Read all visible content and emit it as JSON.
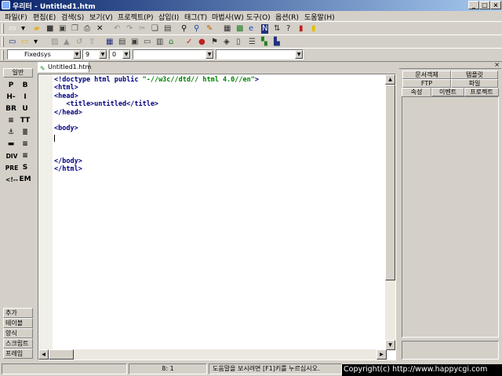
{
  "window": {
    "title": "우리터 - Untitled1.htm",
    "controls": [
      "_",
      "□",
      "×"
    ]
  },
  "menu": [
    "파일(F)",
    "편집(E)",
    "검색(S)",
    "보기(V)",
    "프로젝트(P)",
    "삽입(I)",
    "태그(T)",
    "마법사(W)",
    "도구(O)",
    "옵션(R)",
    "도움말(H)"
  ],
  "toolbar1": [
    {
      "icon": "new-document-icon",
      "glyph": "▭",
      "color": "#ffffff"
    },
    {
      "icon": "new-dropdown-icon",
      "glyph": "▾",
      "color": "#000000"
    },
    {
      "icon": "open-folder-icon",
      "glyph": "▰",
      "color": "#e0b020"
    },
    {
      "icon": "save-icon",
      "glyph": "■",
      "color": "#404040"
    },
    {
      "icon": "save-all-icon",
      "glyph": "▣",
      "color": "#404040"
    },
    {
      "icon": "copy-file-icon",
      "glyph": "❐",
      "color": "#606060"
    },
    {
      "icon": "print-icon",
      "glyph": "⎙",
      "color": "#303030"
    },
    {
      "icon": "delete-icon",
      "glyph": "✕",
      "color": "#000000"
    },
    {
      "icon": "undo-icon",
      "glyph": "↶",
      "color": "#909090"
    },
    {
      "icon": "redo-icon",
      "glyph": "↷",
      "color": "#909090"
    },
    {
      "icon": "cut-icon",
      "glyph": "✂",
      "color": "#909090"
    },
    {
      "icon": "copy-icon",
      "glyph": "❏",
      "color": "#404040"
    },
    {
      "icon": "paste-icon",
      "glyph": "▤",
      "color": "#404040"
    },
    {
      "icon": "find-icon",
      "glyph": "⚲",
      "color": "#000000"
    },
    {
      "icon": "find-replace-icon",
      "glyph": "⚲",
      "color": "#2040a0"
    },
    {
      "icon": "replace-icon",
      "glyph": "✎",
      "color": "#c06000"
    },
    {
      "icon": "html-validate-icon",
      "glyph": "▦",
      "color": "#303030"
    },
    {
      "icon": "image-icon",
      "glyph": "▩",
      "color": "#208020"
    },
    {
      "icon": "preview-ie-icon",
      "glyph": "e",
      "color": "#1050c0"
    },
    {
      "icon": "preview-netscape-icon",
      "glyph": "N",
      "color": "#ffffff",
      "bg": "#203080"
    },
    {
      "icon": "ftp-icon",
      "glyph": "⇅",
      "color": "#303030"
    },
    {
      "icon": "help-icon",
      "glyph": "?",
      "color": "#202020"
    },
    {
      "icon": "book-icon",
      "glyph": "▮",
      "color": "#c02020"
    },
    {
      "icon": "bookmark-icon",
      "glyph": "▮",
      "color": "#e0c000"
    }
  ],
  "toolbar2": [
    {
      "icon": "window-icon",
      "glyph": "▭",
      "color": "#203080"
    },
    {
      "icon": "new-from-template-icon",
      "glyph": "▭",
      "color": "#e0b020"
    },
    {
      "icon": "template-dropdown-icon",
      "glyph": "▾",
      "color": "#000000"
    },
    {
      "icon": "open-remote-icon",
      "glyph": "▨",
      "color": "#909090"
    },
    {
      "icon": "upload-icon",
      "glyph": "▲",
      "color": "#909090"
    },
    {
      "icon": "sync-icon",
      "glyph": "↺",
      "color": "#909090"
    },
    {
      "icon": "publish-icon",
      "glyph": "⇧",
      "color": "#909090"
    },
    {
      "icon": "table-icon",
      "glyph": "▦",
      "color": "#203080"
    },
    {
      "icon": "grid-icon",
      "glyph": "▤",
      "color": "#404040"
    },
    {
      "icon": "frame-icon",
      "glyph": "▣",
      "color": "#404040"
    },
    {
      "icon": "form-icon",
      "glyph": "▭",
      "color": "#404040"
    },
    {
      "icon": "layout-icon",
      "glyph": "▥",
      "color": "#404040"
    },
    {
      "icon": "home-icon",
      "glyph": "⌂",
      "color": "#208020"
    },
    {
      "icon": "spell-check-icon",
      "glyph": "✓",
      "color": "#c02020"
    },
    {
      "icon": "color-picker-icon",
      "glyph": "●",
      "color": "#c02020"
    },
    {
      "icon": "link-check-icon",
      "glyph": "⚑",
      "color": "#303030"
    },
    {
      "icon": "tag-icon",
      "glyph": "◈",
      "color": "#303030"
    },
    {
      "icon": "page-icon",
      "glyph": "▯",
      "color": "#404040"
    },
    {
      "icon": "list-icon",
      "glyph": "☰",
      "color": "#404040"
    },
    {
      "icon": "chart-icon",
      "glyph": "▚",
      "color": "#208020"
    },
    {
      "icon": "bar-chart-icon",
      "glyph": "▙",
      "color": "#203080"
    }
  ],
  "font_toolbar": {
    "font": "Fixedsys",
    "size": "9",
    "spacing": "0",
    "style": "",
    "class": ""
  },
  "palette": {
    "top_tab": "일반",
    "cells": [
      [
        "P",
        "B"
      ],
      [
        "H-",
        "I"
      ],
      [
        "BR",
        "U"
      ],
      [
        "≡",
        "TT"
      ],
      [
        "⚓",
        "≣"
      ],
      [
        "▬",
        "≡"
      ],
      [
        "DIV",
        "≡"
      ],
      [
        "PRE",
        "S"
      ],
      [
        "<!--",
        "EM"
      ]
    ],
    "bottom_tabs": [
      "추가",
      "테이블",
      "양식",
      "스크립트",
      "프레임"
    ]
  },
  "editor": {
    "tab_label": "Untitled1.htm",
    "lines": [
      [
        "<!doctype html public ",
        "\"-//w3c//dtd// html 4.0//en\"",
        ">"
      ],
      [
        "<html>"
      ],
      [
        "<head>"
      ],
      [
        "   <title>untitled</title>"
      ],
      [
        "</head>"
      ],
      [
        ""
      ],
      [
        "<body>"
      ],
      [
        ""
      ],
      [
        ""
      ],
      [
        ""
      ],
      [
        "</body>"
      ],
      [
        "</html>"
      ]
    ]
  },
  "right_panel": {
    "tabs_row1": [
      "문서객체",
      "템플릿"
    ],
    "tabs_row2": [
      "FTP",
      "파일"
    ],
    "tabs_row3": [
      "속성",
      "이벤트",
      "프로젝트"
    ]
  },
  "status": {
    "position": "8:  1",
    "message": "도움말을 보시려면 [F1]키를 누르십시오.",
    "copyright": "Copyright(c) http://www.happycgi.com"
  }
}
